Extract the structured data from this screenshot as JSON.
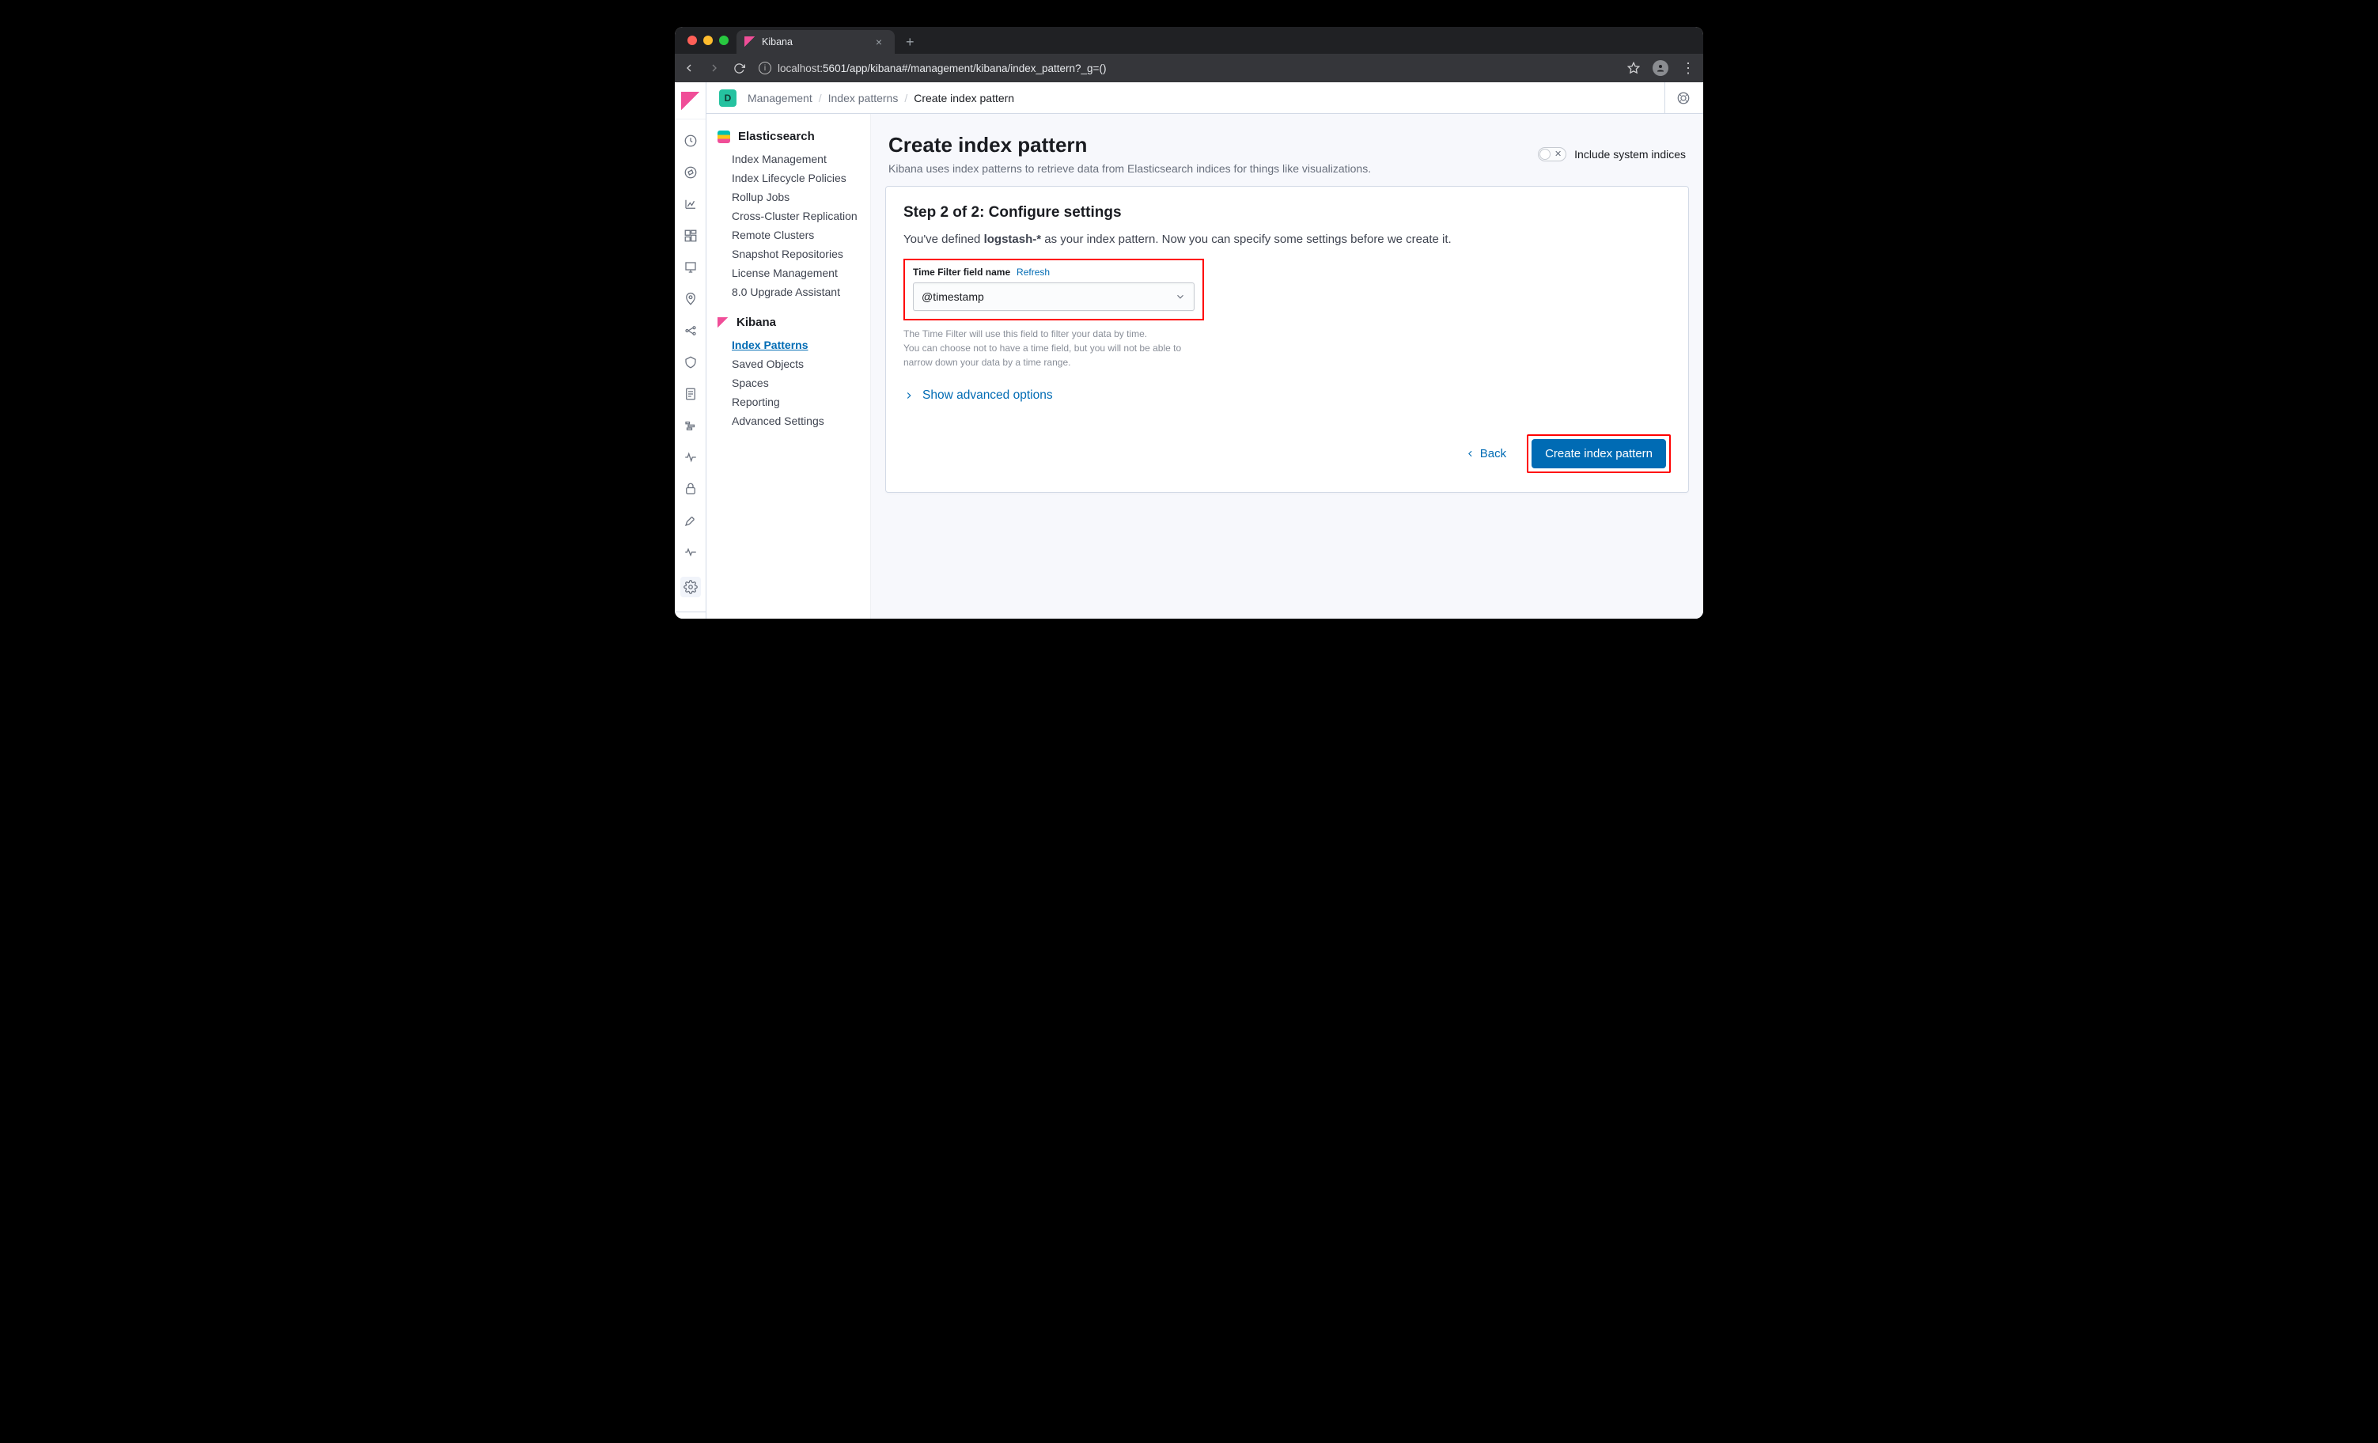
{
  "browser": {
    "tab_title": "Kibana",
    "url_host": "localhost",
    "url_port_path": ":5601/app/kibana#/management/kibana/index_pattern?_g=()"
  },
  "breadcrumb": {
    "space_letter": "D",
    "items": [
      "Management",
      "Index patterns",
      "Create index pattern"
    ]
  },
  "sidebar": {
    "sections": [
      {
        "title": "Elasticsearch",
        "items": [
          "Index Management",
          "Index Lifecycle Policies",
          "Rollup Jobs",
          "Cross-Cluster Replication",
          "Remote Clusters",
          "Snapshot Repositories",
          "License Management",
          "8.0 Upgrade Assistant"
        ]
      },
      {
        "title": "Kibana",
        "items": [
          "Index Patterns",
          "Saved Objects",
          "Spaces",
          "Reporting",
          "Advanced Settings"
        ],
        "active_index": 0
      }
    ]
  },
  "page": {
    "title": "Create index pattern",
    "subtitle": "Kibana uses index patterns to retrieve data from Elasticsearch indices for things like visualizations.",
    "include_system_label": "Include system indices"
  },
  "step": {
    "title": "Step 2 of 2: Configure settings",
    "desc_pre": "You've defined ",
    "desc_bold": "logstash-*",
    "desc_post": " as your index pattern. Now you can specify some settings before we create it.",
    "field_label": "Time Filter field name",
    "refresh_label": "Refresh",
    "select_value": "@timestamp",
    "helper_l1": "The Time Filter will use this field to filter your data by time.",
    "helper_l2": "You can choose not to have a time field, but you will not be able to narrow down your data by a time range.",
    "advanced_label": "Show advanced options",
    "back_label": "Back",
    "create_label": "Create index pattern"
  }
}
